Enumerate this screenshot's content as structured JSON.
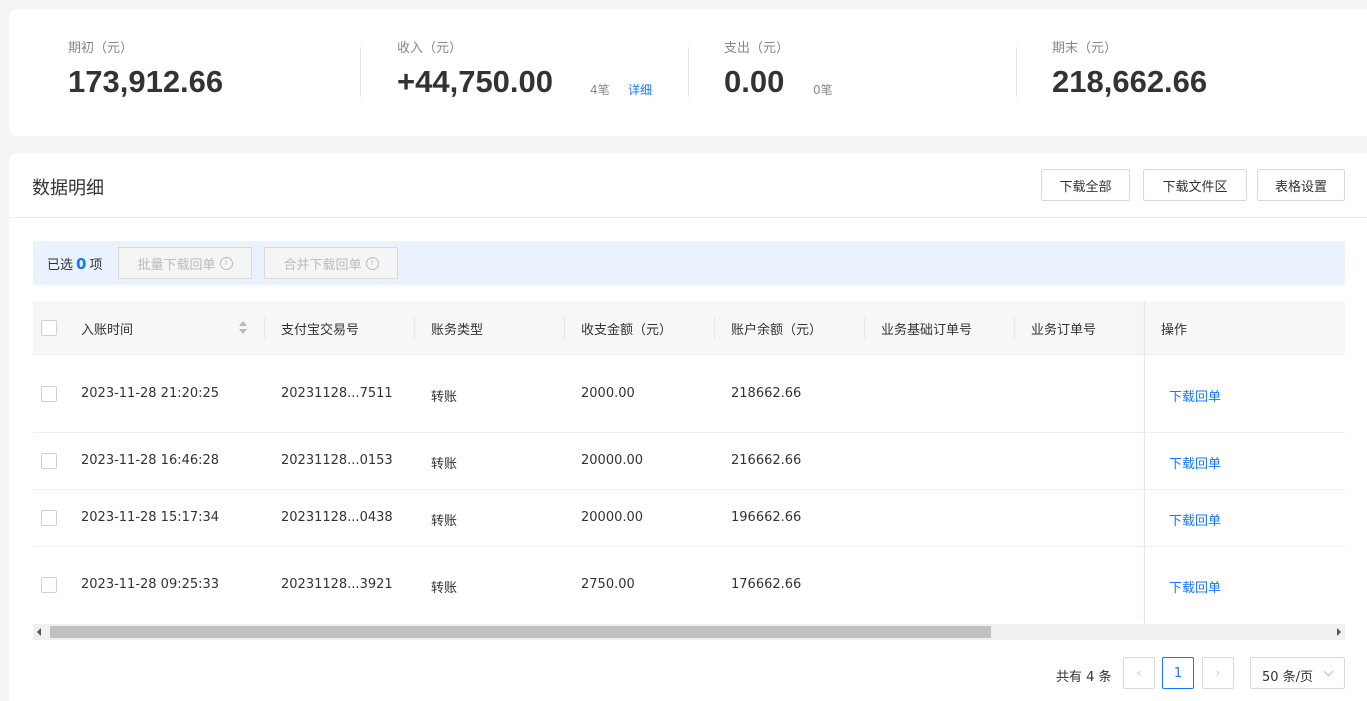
{
  "summary": {
    "opening": {
      "label": "期初（元）",
      "value": "173,912.66"
    },
    "income": {
      "label": "收入（元）",
      "value": "+44,750.00",
      "count": "4笔",
      "detail": "详细"
    },
    "expense": {
      "label": "支出（元）",
      "value": "0.00",
      "count": "0笔"
    },
    "closing": {
      "label": "期末（元）",
      "value": "218,662.66"
    }
  },
  "panel": {
    "title": "数据明细",
    "buttons": {
      "download_all": "下载全部",
      "download_files": "下载文件区",
      "table_settings": "表格设置"
    }
  },
  "selection": {
    "prefix": "已选",
    "count": "0",
    "suffix": "项",
    "batch_download": "批量下载回单",
    "merge_download": "合并下载回单"
  },
  "table": {
    "columns": [
      "入账时间",
      "支付宝交易号",
      "账务类型",
      "收支金额（元）",
      "账户余额（元）",
      "业务基础订单号",
      "业务订单号",
      "操作"
    ],
    "rows": [
      {
        "time": "2023-11-28 21:20:25",
        "trade_no": "20231128...7511",
        "type": "转账",
        "amount": "2000.00",
        "balance": "218662.66",
        "op": "下载回单"
      },
      {
        "time": "2023-11-28 16:46:28",
        "trade_no": "20231128...0153",
        "type": "转账",
        "amount": "20000.00",
        "balance": "216662.66",
        "op": "下载回单"
      },
      {
        "time": "2023-11-28 15:17:34",
        "trade_no": "20231128...0438",
        "type": "转账",
        "amount": "20000.00",
        "balance": "196662.66",
        "op": "下载回单"
      },
      {
        "time": "2023-11-28 09:25:33",
        "trade_no": "20231128...3921",
        "type": "转账",
        "amount": "2750.00",
        "balance": "176662.66",
        "op": "下载回单"
      }
    ]
  },
  "pagination": {
    "total": "共有 4 条",
    "current_page": "1",
    "page_size": "50 条/页"
  }
}
